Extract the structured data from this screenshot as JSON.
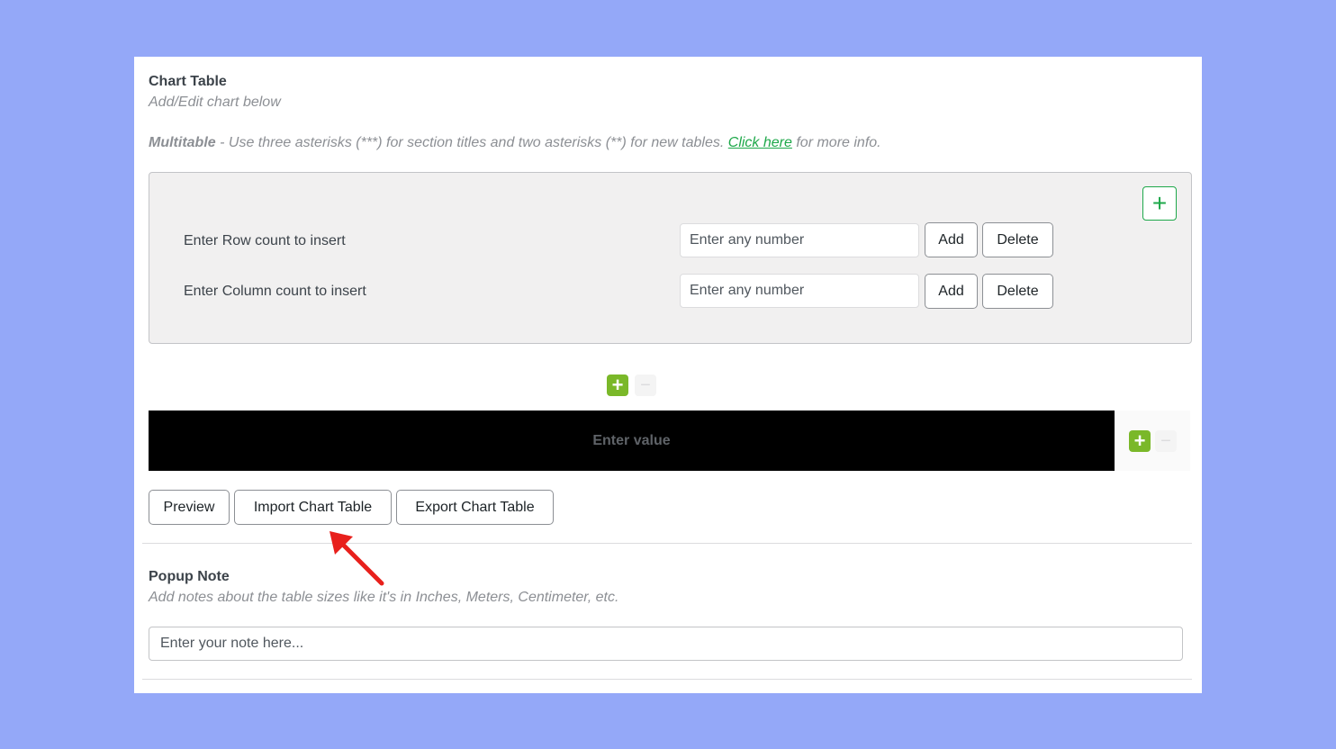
{
  "chart_table": {
    "title": "Chart Table",
    "subtitle": "Add/Edit chart below",
    "multitable_label": "Multitable",
    "multitable_text": " - Use three asterisks (***) for section titles and two asterisks (**) for new tables. ",
    "link_text": "Click here",
    "more_info_text": " for more info."
  },
  "insert_box": {
    "add_icon": "plus-icon",
    "row_label": "Enter Row count to insert",
    "column_label": "Enter Column count to insert",
    "input_placeholder": "Enter any number",
    "add_label": "Add",
    "delete_label": "Delete"
  },
  "table_editor": {
    "add_symbol": "+",
    "remove_symbol": "−",
    "cell_placeholder": "Enter value"
  },
  "actions": {
    "preview_label": "Preview",
    "import_label": "Import Chart Table",
    "export_label": "Export Chart Table"
  },
  "popup_note": {
    "title": "Popup Note",
    "subtitle": "Add notes about the table sizes like it's in Inches, Meters, Centimeter, etc.",
    "placeholder": "Enter your note here..."
  },
  "colors": {
    "page_background": "#94a8f8",
    "accent_green": "#1ea84a",
    "add_green": "#7ab829",
    "annotation_arrow": "#e8201c"
  }
}
